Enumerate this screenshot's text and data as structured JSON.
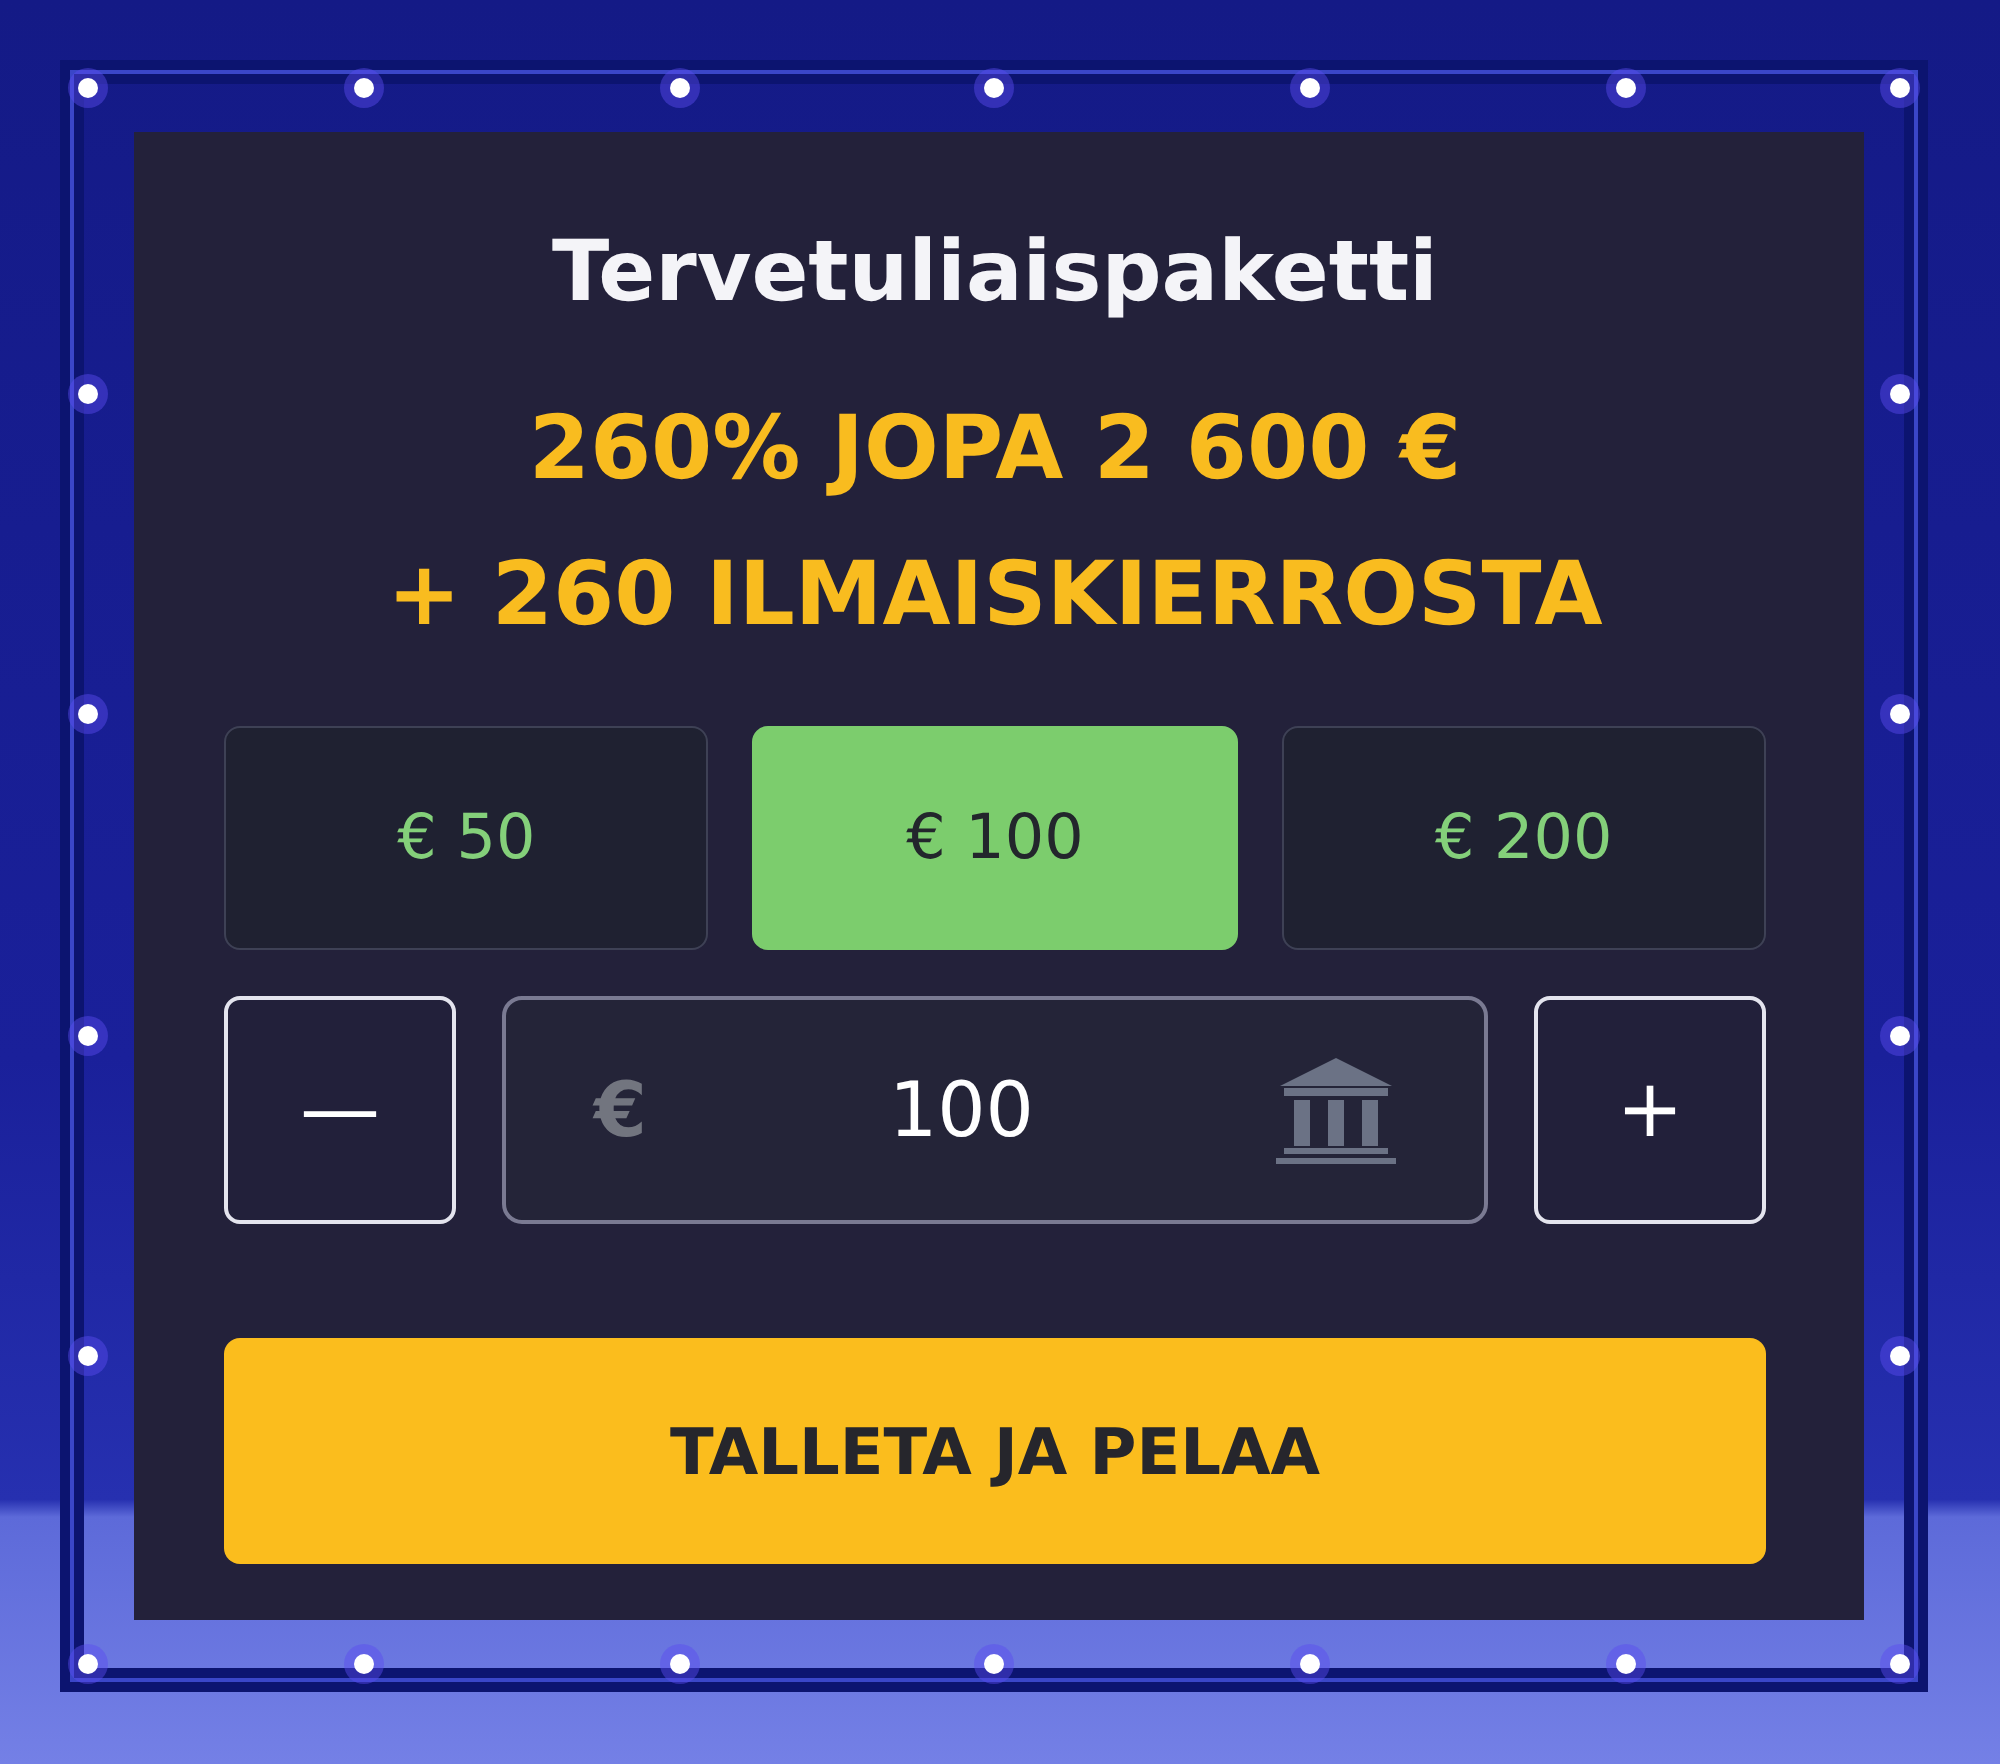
{
  "title": "Tervetuliaispaketti",
  "headline": [
    "260% JOPA 2 600 €",
    "+ 260 ILMAISKIERROSTA"
  ],
  "amounts": [
    {
      "label": "€ 50",
      "selected": false
    },
    {
      "label": "€ 100",
      "selected": true
    },
    {
      "label": "€ 200",
      "selected": false
    }
  ],
  "stepper": {
    "decrease": "—",
    "currency": "€",
    "value": "100",
    "increase": "+"
  },
  "cta": "TALLETA JA PELAA"
}
